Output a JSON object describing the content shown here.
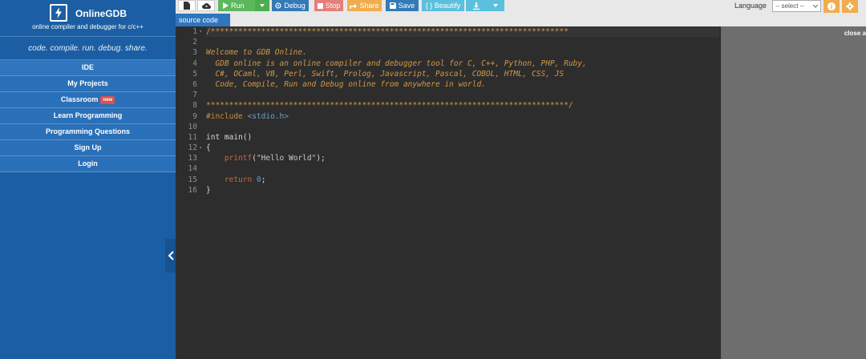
{
  "brand": {
    "title": "OnlineGDB",
    "subtitle": "online compiler and debugger for c/c++",
    "tagline": "code. compile. run. debug. share."
  },
  "nav": {
    "ide": "IDE",
    "my_projects": "My Projects",
    "classroom": "Classroom",
    "classroom_badge": "new",
    "learn_programming": "Learn Programming",
    "programming_questions": "Programming Questions",
    "sign_up": "Sign Up",
    "login": "Login"
  },
  "toolbar": {
    "run": "Run",
    "debug": "Debug",
    "stop": "Stop",
    "share": "Share",
    "save": "Save",
    "beautify": "{ } Beautify",
    "language_label": "Language",
    "language_value": "-- select --"
  },
  "tabs": {
    "source_code": "source code"
  },
  "editor": {
    "line_numbers": [
      "1",
      "2",
      "3",
      "4",
      "5",
      "6",
      "7",
      "8",
      "9",
      "10",
      "11",
      "12",
      "13",
      "14",
      "15",
      "16"
    ],
    "lines": [
      "/******************************************************************************",
      "",
      "Welcome to GDB Online.",
      "  GDB online is an online compiler and debugger tool for C, C++, Python, PHP, Ruby,",
      "  C#, OCaml, VB, Perl, Swift, Prolog, Javascript, Pascal, COBOL, HTML, CSS, JS",
      "  Code, Compile, Run and Debug online from anywhere in world.",
      "",
      "*******************************************************************************/",
      "#include <stdio.h>",
      "",
      "int main()",
      "{",
      "    printf(\"Hello World\");",
      "",
      "    return 0;",
      "}"
    ]
  },
  "right_panel": {
    "close_ad": "close a"
  },
  "colors": {
    "sidebar": "#1b5ea3",
    "nav_item": "#2a70b8",
    "editor_bg": "#2d2d2d",
    "comment": "#d39745",
    "run_green": "#5cb85c",
    "debug_blue": "#337ab7",
    "stop_red": "#e47f7b",
    "share_orange": "#f0ad4e",
    "beautify_cyan": "#5bc0de"
  }
}
